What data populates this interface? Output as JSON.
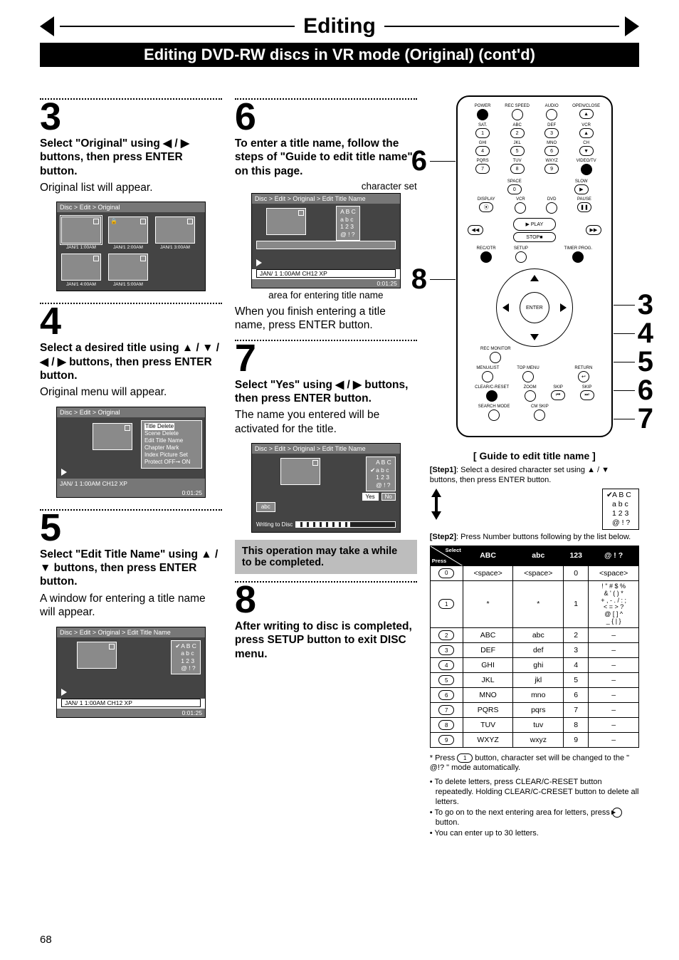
{
  "header": {
    "title": "Editing",
    "subtitle": "Editing DVD-RW discs in VR mode (Original) (cont'd)"
  },
  "page_number": "68",
  "col1": {
    "s3": {
      "num": "3",
      "head": "Select \"Original\" using ◀ / ▶ buttons, then press ENTER button.",
      "body": "Original list will appear."
    },
    "s4": {
      "num": "4",
      "head": "Select a desired title using ▲ / ▼ / ◀ / ▶ buttons, then press ENTER button.",
      "body": "Original menu will appear."
    },
    "s5": {
      "num": "5",
      "head": "Select \"Edit Title Name\" using ▲ / ▼ buttons, then press ENTER button.",
      "body": "A window for entering a title name will appear."
    }
  },
  "col2": {
    "s6": {
      "num": "6",
      "head": "To enter a title name, follow the steps of \"Guide to edit title name\" on this page.",
      "cap_charset": "character set",
      "cap_area": "area for entering title name",
      "tail": "When you finish entering a title name, press ENTER button."
    },
    "s7": {
      "num": "7",
      "head": "Select \"Yes\" using ◀ / ▶ buttons, then press ENTER button.",
      "body": "The name you entered will be activated for the title."
    },
    "note": "This operation may take a while to be completed.",
    "s8": {
      "num": "8",
      "head": "After writing to disc is completed, press SETUP button to exit DISC menu."
    }
  },
  "osd": {
    "bc_original": "Disc > Edit > Original",
    "bc_edit_title": "Disc > Edit > Original > Edit Title Name",
    "thumbs": [
      "JAN/1  1:00AM",
      "JAN/1  2:00AM",
      "JAN/1  3:00AM",
      "JAN/1  4:00AM",
      "JAN/1  5:00AM"
    ],
    "menu": [
      "Title Delete",
      "Scene Delete",
      "Edit Title Name",
      "Chapter Mark",
      "Index Picture Set",
      "Protect OFF➞ ON"
    ],
    "foot": "JAN/ 1   1:00AM  CH12    XP",
    "time": "0:01:25",
    "charset": [
      "A B C",
      "a b c",
      "1 2 3",
      "@ ! ?"
    ],
    "entry_text": "abc",
    "yes": "Yes",
    "no": "No",
    "writing": "Writing to Disc"
  },
  "remote": {
    "row1": [
      "POWER",
      "REC SPEED",
      "AUDIO",
      "OPEN/CLOSE"
    ],
    "numlabels": [
      "",
      "ABC",
      "DEF",
      "GHI",
      "JKL",
      "MNO",
      "PQRS",
      "TUV",
      "WXYZ"
    ],
    "rlabels1": [
      "SAT.",
      "VCR",
      "CH"
    ],
    "rlabels2": [
      "",
      "",
      "VIDEO/TV"
    ],
    "space": "SPACE",
    "slow": "SLOW",
    "display": "DISPLAY",
    "vcr2": "VCR",
    "dvd": "DVD",
    "pause": "PAUSE",
    "play": "PLAY",
    "stop": "STOP",
    "rec": "REC/OTR",
    "setup": "SETUP",
    "timer": "TIMER PROG.",
    "enter": "ENTER",
    "recmon": "REC MONITOR",
    "menulist": "MENU/LIST",
    "topmenu": "TOP MENU",
    "return": "RETURN",
    "clear": "CLEAR/C-RESET",
    "zoom": "ZOOM",
    "skip": "SKIP",
    "search": "SEARCH MODE",
    "cmskip": "CM SKIP",
    "callouts_left": {
      "c6": "6",
      "c8": "8"
    },
    "callouts_right": {
      "c3": "3",
      "c4": "4",
      "c5": "5",
      "c6": "6",
      "c7": "7"
    }
  },
  "guide": {
    "title": "[ Guide to edit title name ]",
    "step1_label": "[Step1]",
    "step1_text": ": Select a desired character set using ▲ / ▼ buttons, then press ENTER button.",
    "step2_label": "[Step2]",
    "step2_text": ": Press Number buttons following by the list below.",
    "charset": [
      "A B C",
      "a b c",
      "1 2 3",
      "@ ! ?"
    ],
    "table": {
      "head_diag_top": "Select",
      "head_diag_bot": "Press",
      "head": [
        "ABC",
        "abc",
        "123",
        "@ ! ?"
      ],
      "rows": [
        {
          "k": "0",
          "c": [
            "<space>",
            "<space>",
            "0",
            "<space>"
          ]
        },
        {
          "k": "1",
          "c": [
            "*",
            "*",
            "1",
            "! \" # $ %\n& ' ( ) *\n+ , - . / : ;\n< = > ?\n@ [ ] ^\n_ { | }"
          ]
        },
        {
          "k": "2",
          "c": [
            "ABC",
            "abc",
            "2",
            "–"
          ]
        },
        {
          "k": "3",
          "c": [
            "DEF",
            "def",
            "3",
            "–"
          ]
        },
        {
          "k": "4",
          "c": [
            "GHI",
            "ghi",
            "4",
            "–"
          ]
        },
        {
          "k": "5",
          "c": [
            "JKL",
            "jkl",
            "5",
            "–"
          ]
        },
        {
          "k": "6",
          "c": [
            "MNO",
            "mno",
            "6",
            "–"
          ]
        },
        {
          "k": "7",
          "c": [
            "PQRS",
            "pqrs",
            "7",
            "–"
          ]
        },
        {
          "k": "8",
          "c": [
            "TUV",
            "tuv",
            "8",
            "–"
          ]
        },
        {
          "k": "9",
          "c": [
            "WXYZ",
            "wxyz",
            "9",
            "–"
          ]
        }
      ]
    },
    "footnote_star": "* Press        button, character set will be changed to the \" @!? \" mode automatically.",
    "footnote_key": "1",
    "bullets": [
      "To delete letters, press CLEAR/C-RESET button repeatedly. Holding CLEAR/C-CRESET button to delete all letters.",
      "To go on to the next entering area for letters, press        button.",
      "You can enter up to 30 letters."
    ],
    "bullet2_key": "▶"
  }
}
